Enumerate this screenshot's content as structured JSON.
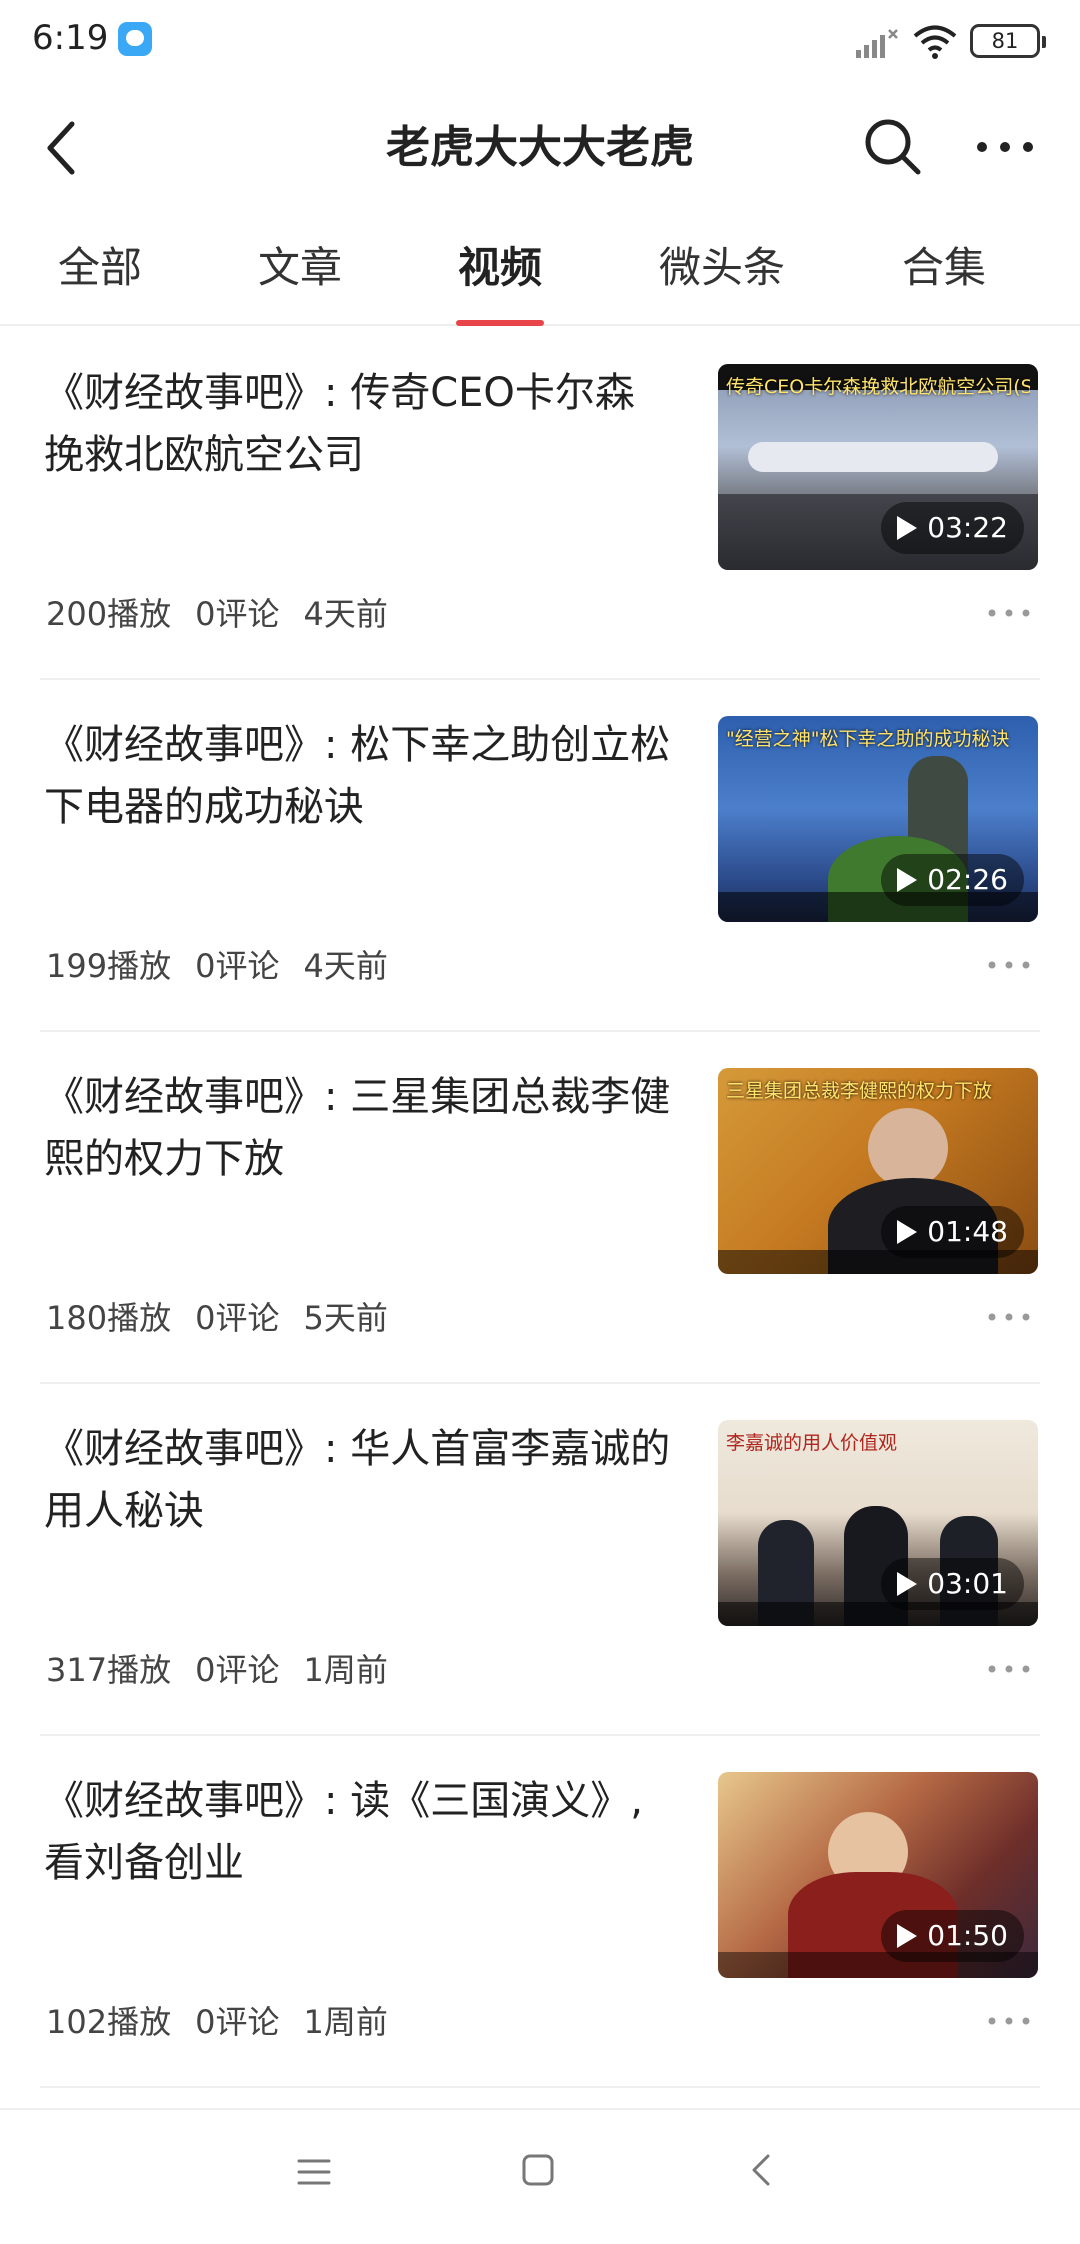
{
  "status_bar": {
    "time": "6:19",
    "battery": "81"
  },
  "header": {
    "title": "老虎大大大老虎"
  },
  "tabs": [
    {
      "label": "全部"
    },
    {
      "label": "文章"
    },
    {
      "label": "视频"
    },
    {
      "label": "微头条"
    },
    {
      "label": "合集"
    }
  ],
  "active_tab": "视频",
  "accent_color": "#e8454a",
  "videos": [
    {
      "title": "《财经故事吧》: 传奇CEO卡尔森挽救北欧航空公司",
      "thumb_caption": "传奇CEO卡尔森挽救北欧航空公司(SAS)",
      "duration": "03:22",
      "plays": "200播放",
      "comments": "0评论",
      "time": "4天前"
    },
    {
      "title": "《财经故事吧》: 松下幸之助创立松下电器的成功秘诀",
      "thumb_caption": "\"经营之神\"松下幸之助的成功秘诀",
      "duration": "02:26",
      "plays": "199播放",
      "comments": "0评论",
      "time": "4天前"
    },
    {
      "title": "《财经故事吧》: 三星集团总裁李健熙的权力下放",
      "thumb_caption": "三星集团总裁李健熙的权力下放",
      "duration": "01:48",
      "plays": "180播放",
      "comments": "0评论",
      "time": "5天前"
    },
    {
      "title": "《财经故事吧》: 华人首富李嘉诚的用人秘诀",
      "thumb_caption": "李嘉诚的用人价值观",
      "duration": "03:01",
      "plays": "317播放",
      "comments": "0评论",
      "time": "1周前"
    },
    {
      "title": "《财经故事吧》: 读《三国演义》, 看刘备创业",
      "thumb_caption": "",
      "duration": "01:50",
      "plays": "102播放",
      "comments": "0评论",
      "time": "1周前"
    }
  ],
  "icons": {
    "back": "back-arrow-icon",
    "search": "search-icon",
    "more": "more-dots-icon",
    "nav_menu": "menu-icon",
    "nav_home": "home-square-icon",
    "nav_back": "back-chevron-icon"
  }
}
